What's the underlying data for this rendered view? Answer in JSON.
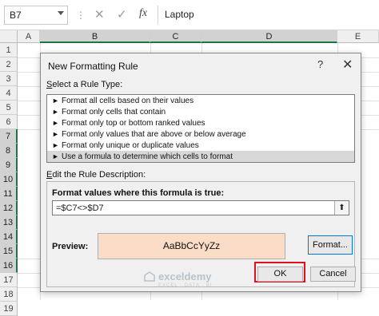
{
  "formula_bar": {
    "name_box": "B7",
    "cancel_glyph": "✕",
    "enter_glyph": "✓",
    "fx": "fx",
    "content": "Laptop"
  },
  "columns": [
    "A",
    "B",
    "C",
    "D",
    "E"
  ],
  "selected_columns": [
    "B",
    "C",
    "D"
  ],
  "rows": [
    "1",
    "2",
    "3",
    "4",
    "5",
    "6",
    "7",
    "8",
    "9",
    "10",
    "11",
    "12",
    "13",
    "14",
    "15",
    "16",
    "17",
    "18",
    "19"
  ],
  "selected_rows": [
    "7",
    "8",
    "9",
    "10",
    "11",
    "12",
    "13",
    "14",
    "15",
    "16"
  ],
  "dialog": {
    "title": "New Formatting Rule",
    "help_glyph": "?",
    "close_glyph": "✕",
    "select_label_prefix": "S",
    "select_label_rest": "elect a Rule Type:",
    "rule_types": [
      "Format all cells based on their values",
      "Format only cells that contain",
      "Format only top or bottom ranked values",
      "Format only values that are above or below average",
      "Format only unique or duplicate values",
      "Use a formula to determine which cells to format"
    ],
    "selected_rule_index": 5,
    "edit_label_prefix": "E",
    "edit_label_rest": "dit the Rule Description:",
    "formula_heading": "Format values where this formula is true:",
    "formula_value": "=$C7<>$D7",
    "collapse_glyph": "⬆",
    "preview_label": "Preview:",
    "preview_sample": "AaBbCcYyZz",
    "format_button": "Format...",
    "ok_button": "OK",
    "cancel_button": "Cancel"
  },
  "watermark": {
    "name": "exceldemy",
    "tagline": "EXCEL · DATA · BI"
  },
  "colors": {
    "excel_green": "#217346",
    "preview_fill": "#fbdcc6",
    "highlight_red": "#e0101f"
  }
}
